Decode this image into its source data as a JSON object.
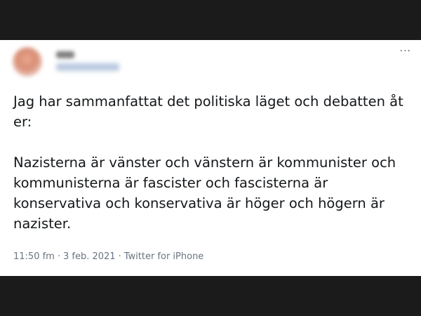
{
  "tweet": {
    "more_options_icon": "more-options-icon",
    "text": {
      "paragraph_1": "Jag har sammanfattat det politiska läget och debatten åt er:",
      "paragraph_2": "Nazisterna är vänster och vänstern är kommunister och kommunisterna är fascister och fascisterna är konservativa och konservativa är höger och högern är nazister."
    },
    "meta": {
      "time": "11:50 fm",
      "date": "3 feb. 2021",
      "separator": "·",
      "source": "Twitter for iPhone"
    }
  }
}
